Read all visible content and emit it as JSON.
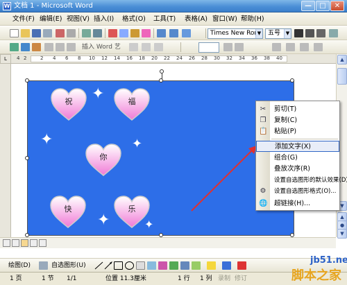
{
  "window": {
    "title": "文档 1 - Microsoft Word",
    "app_icon": "W",
    "minimize": "—",
    "maximize": "□",
    "close": "✕"
  },
  "menubar": {
    "items": [
      "文件(F)",
      "编辑(E)",
      "视图(V)",
      "插入(I)",
      "格式(O)",
      "工具(T)",
      "表格(A)",
      "窗口(W)",
      "帮助(H)"
    ]
  },
  "toolbar": {
    "font_name": "Times New Roma",
    "font_size": "五号",
    "insert_word_art": "插入 Word 艺"
  },
  "document": {
    "hearts": [
      "祝",
      "福",
      "你",
      "快",
      "乐"
    ],
    "canvas_color": "#2d6ee8",
    "heart_color": "#f07ad6"
  },
  "ruler": {
    "numbers": [
      "4",
      "2",
      "",
      "2",
      "4",
      "6",
      "8",
      "10",
      "12",
      "14",
      "16",
      "18",
      "20",
      "22",
      "24",
      "26",
      "28",
      "30",
      "32",
      "34",
      "36",
      "38",
      "40"
    ]
  },
  "context_menu": {
    "items": [
      {
        "label": "剪切(T)",
        "icon": "scissors-icon"
      },
      {
        "label": "复制(C)",
        "icon": "copy-icon"
      },
      {
        "label": "粘贴(P)",
        "icon": "paste-icon"
      },
      {
        "label": "添加文字(X)",
        "icon": "",
        "highlighted": true
      },
      {
        "label": "组合(G)",
        "icon": ""
      },
      {
        "label": "叠放次序(R)",
        "icon": ""
      },
      {
        "label": "设置自选图形的默认效果(D)",
        "icon": ""
      },
      {
        "label": "设置自选图形格式(O)...",
        "icon": "format-icon"
      },
      {
        "label": "超链接(H)...",
        "icon": "hyperlink-icon"
      }
    ]
  },
  "drawbar": {
    "draw_label": "绘图(D)",
    "autoshapes_label": "自选图形(U)"
  },
  "statusbar": {
    "page": "1 页",
    "section": "1 节",
    "page_of": "1/1",
    "position": "位置 11.3厘米",
    "line": "1 行",
    "column": "1 列",
    "rec": "录制",
    "trk": "修订"
  },
  "watermark": {
    "line1": "jb51.net",
    "line2": "脚本之家"
  }
}
